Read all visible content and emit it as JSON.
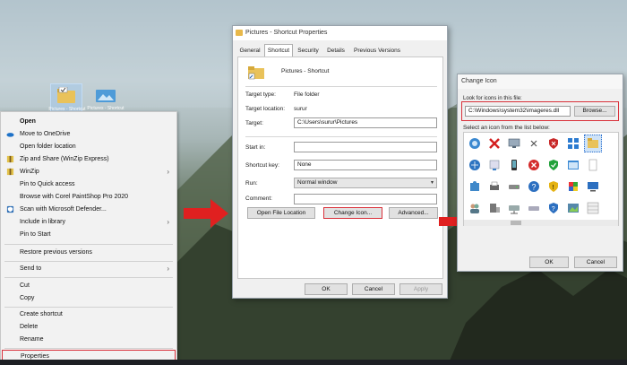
{
  "desktop": {
    "icons": [
      {
        "label": "Pictures - Shortcut"
      },
      {
        "label": "Pictures - Shortcut"
      }
    ]
  },
  "context_menu": {
    "items": [
      {
        "label": "Open",
        "bold": true
      },
      {
        "label": "Move to OneDrive",
        "icon": "onedrive-icon"
      },
      {
        "label": "Open folder location"
      },
      {
        "label": "Zip and Share (WinZip Express)",
        "icon": "winzip-icon"
      },
      {
        "label": "WinZip",
        "icon": "winzip-icon",
        "submenu": true
      },
      {
        "label": "Pin to Quick access"
      },
      {
        "label": "Browse with Corel PaintShop Pro 2020"
      },
      {
        "label": "Scan with Microsoft Defender...",
        "icon": "defender-icon"
      },
      {
        "label": "Include in library",
        "submenu": true
      },
      {
        "label": "Pin to Start"
      },
      {
        "label": "Restore previous versions"
      },
      {
        "label": "Send to",
        "submenu": true
      },
      {
        "label": "Cut"
      },
      {
        "label": "Copy"
      },
      {
        "label": "Create shortcut"
      },
      {
        "label": "Delete"
      },
      {
        "label": "Rename"
      },
      {
        "label": "Properties"
      }
    ]
  },
  "properties_dialog": {
    "title": "Pictures - Shortcut Properties",
    "tabs": [
      "General",
      "Shortcut",
      "Security",
      "Details",
      "Previous Versions"
    ],
    "active_tab": "Shortcut",
    "header_name": "Pictures - Shortcut",
    "fields": {
      "target_type_label": "Target type:",
      "target_type_value": "File folder",
      "target_location_label": "Target location:",
      "target_location_value": "surur",
      "target_label": "Target:",
      "target_value": "C:\\Users\\surur\\Pictures",
      "start_in_label": "Start in:",
      "start_in_value": "",
      "shortcut_key_label": "Shortcut key:",
      "shortcut_key_value": "None",
      "run_label": "Run:",
      "run_value": "Normal window",
      "comment_label": "Comment:",
      "comment_value": ""
    },
    "buttons": {
      "open_file_location": "Open File Location",
      "change_icon": "Change Icon...",
      "advanced": "Advanced...",
      "ok": "OK",
      "cancel": "Cancel",
      "apply": "Apply"
    }
  },
  "change_icon_dialog": {
    "title": "Change Icon",
    "look_for_label": "Look for icons in this file:",
    "file_path": "C:\\Windows\\system32\\imageres.dll",
    "browse": "Browse...",
    "select_label": "Select an icon from the list below:",
    "ok": "OK",
    "cancel": "Cancel"
  },
  "colors": {
    "highlight": "#d9303a",
    "arrow": "#e02020"
  }
}
